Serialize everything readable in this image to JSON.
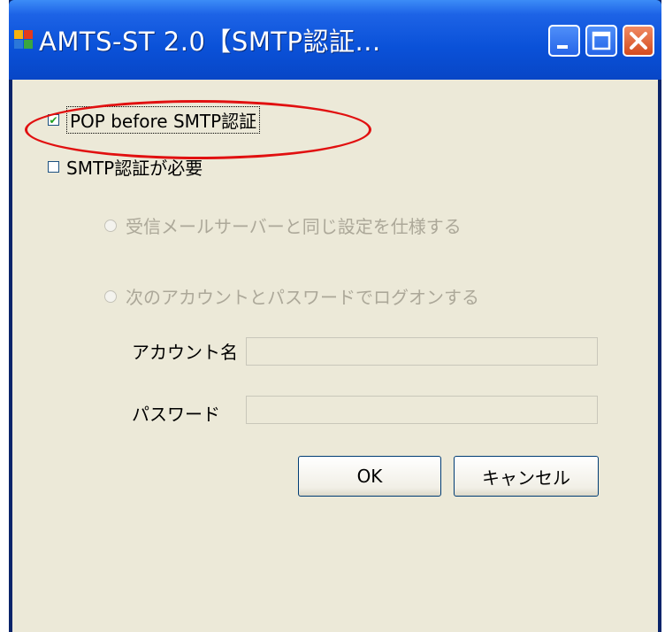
{
  "window": {
    "title": "AMTS-ST 2.0【SMTP認証...",
    "app_icon": "app-window-icon",
    "controls": {
      "minimize": "minimize-icon",
      "maximize": "maximize-icon",
      "close": "close-icon"
    }
  },
  "options": {
    "pop_before_smtp": {
      "label": "POP before SMTP認証",
      "checked": true
    },
    "smtp_auth_required": {
      "label": "SMTP認証が必要",
      "checked": false
    }
  },
  "auth_mode": {
    "same_as_incoming": {
      "label": "受信メールサーバーと同じ設定を仕様する",
      "enabled": false
    },
    "use_account": {
      "label": "次のアカウントとパスワードでログオンする",
      "enabled": false
    }
  },
  "fields": {
    "account": {
      "label": "アカウント名",
      "value": ""
    },
    "password": {
      "label": "パスワード",
      "value": ""
    }
  },
  "buttons": {
    "ok": "OK",
    "cancel": "キャンセル"
  },
  "colors": {
    "title_bar": "#0a51d8",
    "dialog_bg": "#ece9d8",
    "annotation": "#e11010"
  }
}
